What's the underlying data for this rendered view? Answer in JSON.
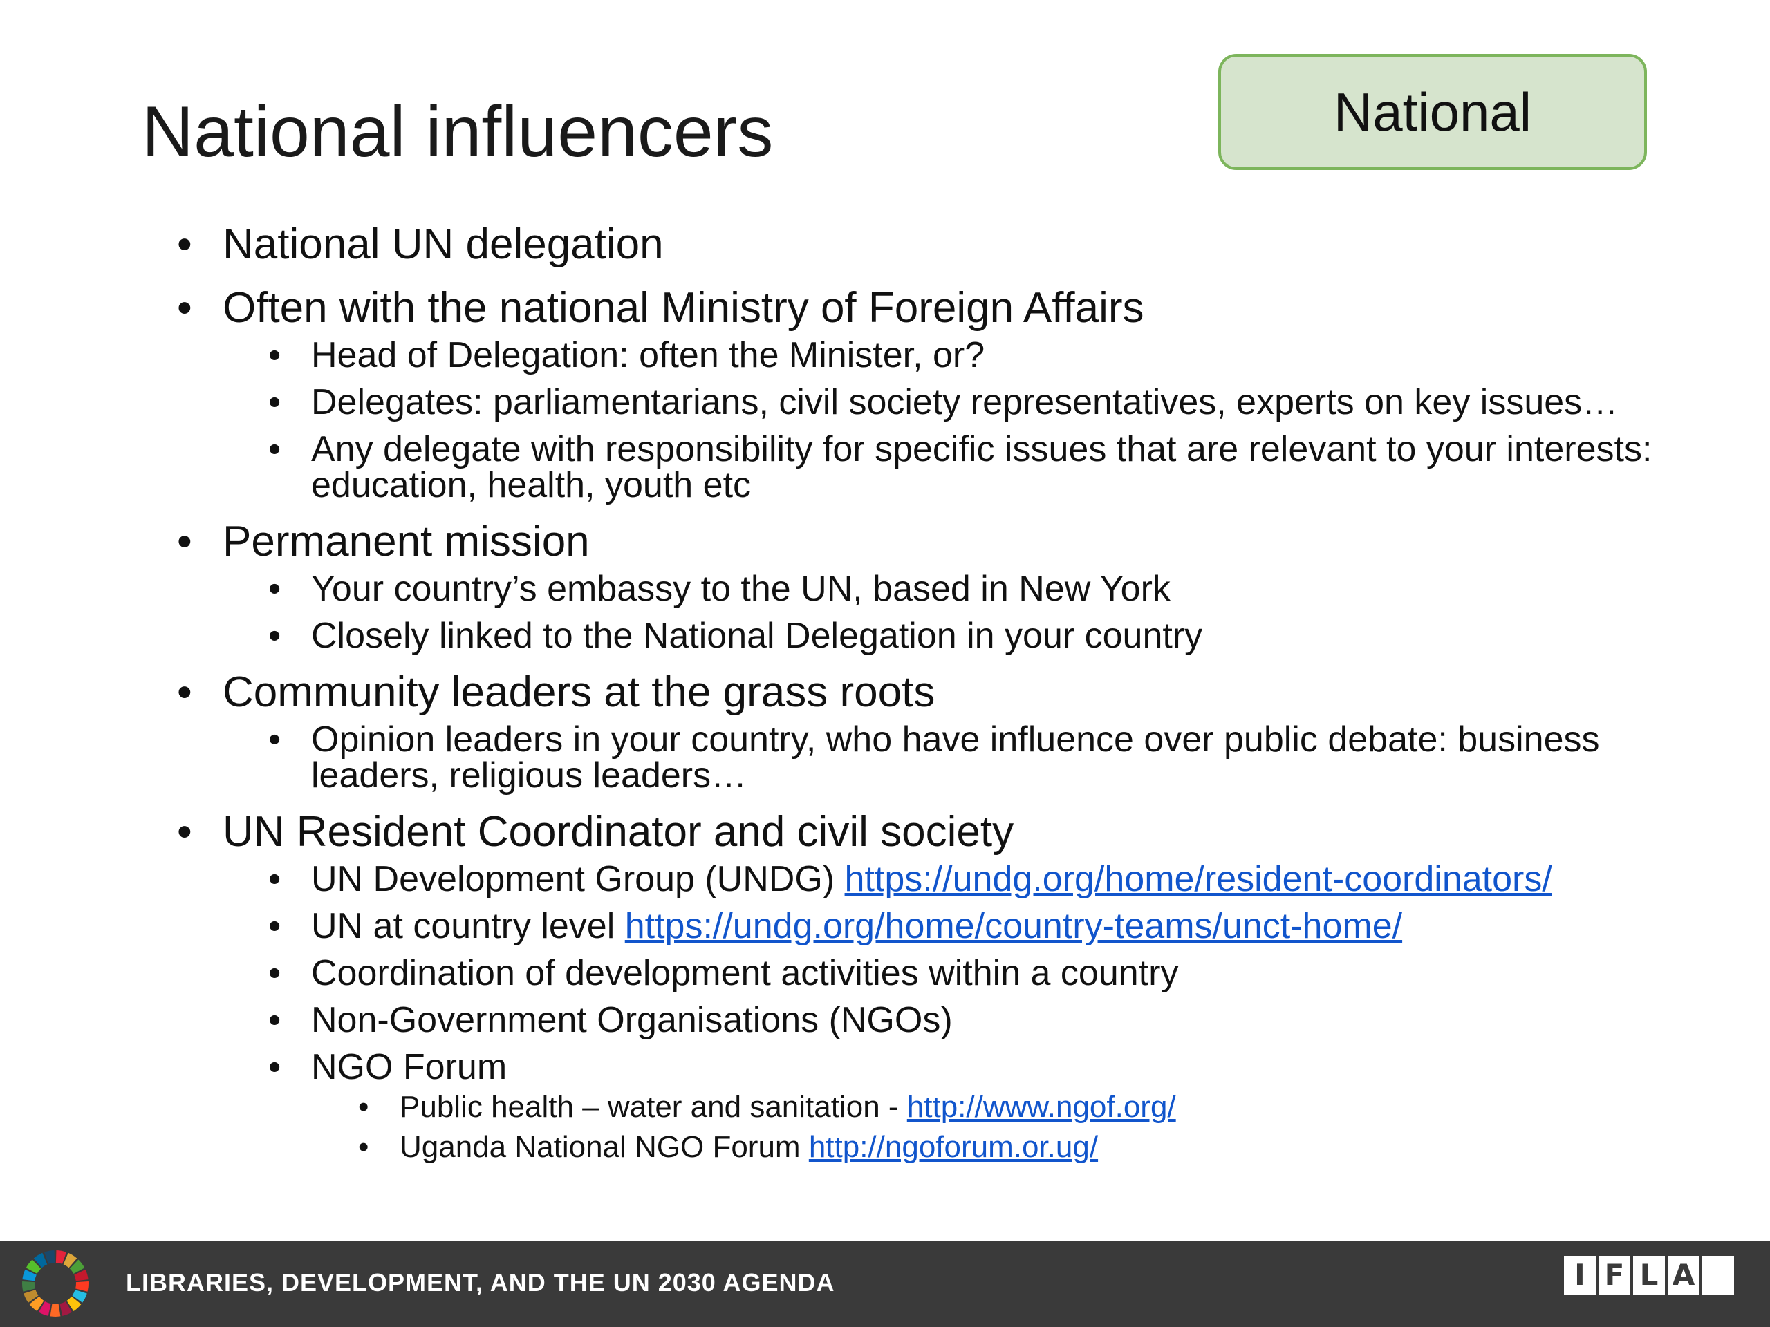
{
  "title": "National influencers",
  "badge": "National",
  "bullets": [
    {
      "text": "National UN delegation"
    },
    {
      "text": "Often with the national Ministry of Foreign Affairs",
      "children": [
        {
          "text": "Head of Delegation: often the Minister, or?"
        },
        {
          "text": "Delegates: parliamentarians, civil society representatives, experts on key issues…"
        },
        {
          "text": "Any delegate with responsibility for specific issues that are relevant to your interests: education, health, youth etc"
        }
      ]
    },
    {
      "text": "Permanent mission",
      "children": [
        {
          "text": "Your country’s embassy to the UN, based in New York"
        },
        {
          "text": "Closely linked to the National Delegation in your country"
        }
      ]
    },
    {
      "text": "Community leaders at the grass roots",
      "children": [
        {
          "text": "Opinion leaders in your country, who have influence over public debate: business leaders, religious leaders…"
        }
      ]
    },
    {
      "text": "UN Resident Coordinator and civil society",
      "children": [
        {
          "text": "UN Development Group (UNDG) ",
          "link": "https://undg.org/home/resident-coordinators/"
        },
        {
          "text": "UN at country level ",
          "link": "https://undg.org/home/country-teams/unct-home/"
        },
        {
          "text": "Coordination of development activities within a country"
        },
        {
          "text": "Non-Government Organisations (NGOs)"
        },
        {
          "text": "NGO Forum",
          "children": [
            {
              "text": "Public health – water and sanitation - ",
              "link": "http://www.ngof.org/"
            },
            {
              "text": "Uganda National NGO Forum ",
              "link": "http://ngoforum.or.ug/"
            }
          ]
        }
      ]
    }
  ],
  "footer": {
    "text": "LIBRARIES, DEVELOPMENT,  AND THE UN 2030 AGENDA",
    "logo_letters": [
      "I",
      "F",
      "L",
      "A",
      ""
    ]
  },
  "colors": {
    "badge_fill": "#d6e4cd",
    "badge_border": "#7db55c",
    "link": "#1155cc",
    "footer_bg": "#3a3a3a"
  }
}
